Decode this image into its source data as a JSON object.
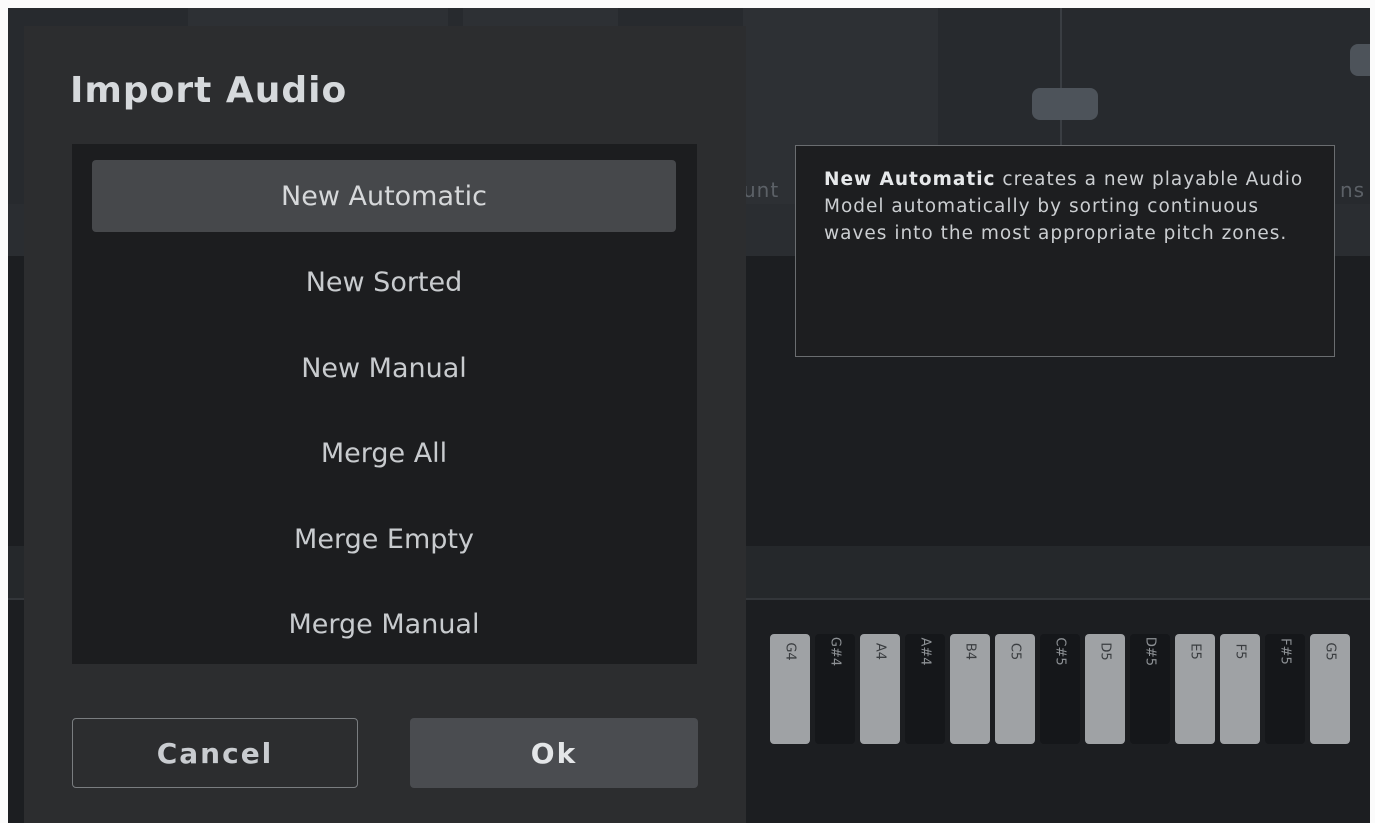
{
  "background": {
    "labels": [
      "unt",
      "ns"
    ],
    "keys": [
      {
        "label": "G4",
        "color": "white"
      },
      {
        "label": "G#4",
        "color": "black"
      },
      {
        "label": "A4",
        "color": "white"
      },
      {
        "label": "A#4",
        "color": "black"
      },
      {
        "label": "B4",
        "color": "white"
      },
      {
        "label": "C5",
        "color": "white"
      },
      {
        "label": "C#5",
        "color": "black"
      },
      {
        "label": "D5",
        "color": "white"
      },
      {
        "label": "D#5",
        "color": "black"
      },
      {
        "label": "E5",
        "color": "white"
      },
      {
        "label": "F5",
        "color": "white"
      },
      {
        "label": "F#5",
        "color": "black"
      },
      {
        "label": "G5",
        "color": "white"
      }
    ]
  },
  "dialog": {
    "title": "Import Audio",
    "options": [
      {
        "label": "New Automatic",
        "selected": true
      },
      {
        "label": "New Sorted",
        "selected": false
      },
      {
        "label": "New Manual",
        "selected": false
      },
      {
        "label": "Merge All",
        "selected": false
      },
      {
        "label": "Merge Empty",
        "selected": false
      },
      {
        "label": "Merge Manual",
        "selected": false
      }
    ],
    "cancel_label": "Cancel",
    "ok_label": "Ok"
  },
  "tooltip": {
    "bold": "New Automatic",
    "text": " creates a new playable Audio Model automatically by sorting continuous waves into the most appropriate pitch zones."
  },
  "colors": {
    "dialog_bg": "#2c2d2f",
    "list_bg": "#1c1d1f",
    "selected_bg": "#46484b",
    "ok_bg": "#4a4c50"
  }
}
